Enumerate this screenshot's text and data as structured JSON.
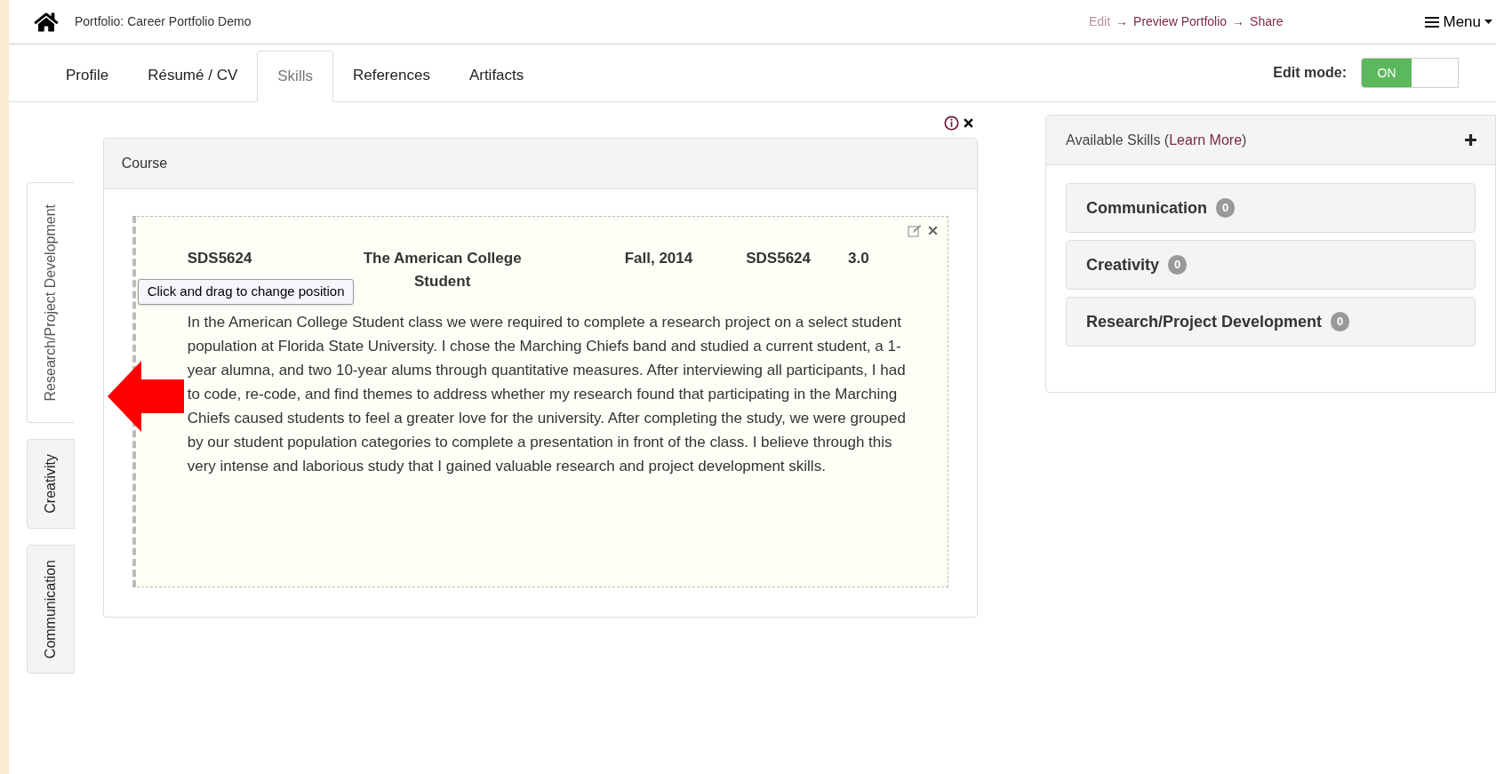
{
  "header": {
    "portfolio_title": "Portfolio: Career Portfolio Demo",
    "steps": [
      {
        "label": "Edit",
        "selected": true
      },
      {
        "label": "Preview Portfolio",
        "selected": false
      },
      {
        "label": "Share",
        "selected": false
      }
    ],
    "step_separator": "→",
    "menu": "Menu"
  },
  "tabs": [
    {
      "label": "Profile",
      "selected": false
    },
    {
      "label": "Résumé / CV",
      "selected": false
    },
    {
      "label": "Skills",
      "selected": true
    },
    {
      "label": "References",
      "selected": false
    },
    {
      "label": "Artifacts",
      "selected": false
    }
  ],
  "edit_mode": {
    "label": "Edit mode:",
    "on": true,
    "on_text": "ON"
  },
  "skill_tabs": [
    {
      "label": "Research/Project Development",
      "selected": true
    },
    {
      "label": "Creativity",
      "selected": false
    },
    {
      "label": "Communication",
      "selected": false
    }
  ],
  "course_panel": {
    "heading": "Course",
    "tooltip": "Click and drag to change position",
    "course": {
      "code": "SDS5624",
      "title": "The American College Student",
      "term": "Fall, 2014",
      "number": "SDS5624",
      "credits": "3.0",
      "description": "In the American College Student class we were required to complete a research project on a select student population at Florida State University. I chose the Marching Chiefs band and studied a current student, a 1-year alumna, and two 10-year alums through quantitative measures. After interviewing all participants, I had to code, re-code, and find themes to address whether my research found that participating in the Marching Chiefs caused students to feel a greater love for the university. After completing the study, we were grouped by our student population categories to complete a presentation in front of the class. I believe through this very intense and laborious study that I gained valuable research and project development skills."
    }
  },
  "available_skills": {
    "title": "Available Skills (",
    "link": "Learn More",
    "title_end": ")",
    "items": [
      {
        "name": "Communication",
        "count": "0"
      },
      {
        "name": "Creativity",
        "count": "0"
      },
      {
        "name": "Research/Project Development",
        "count": "0"
      }
    ]
  }
}
